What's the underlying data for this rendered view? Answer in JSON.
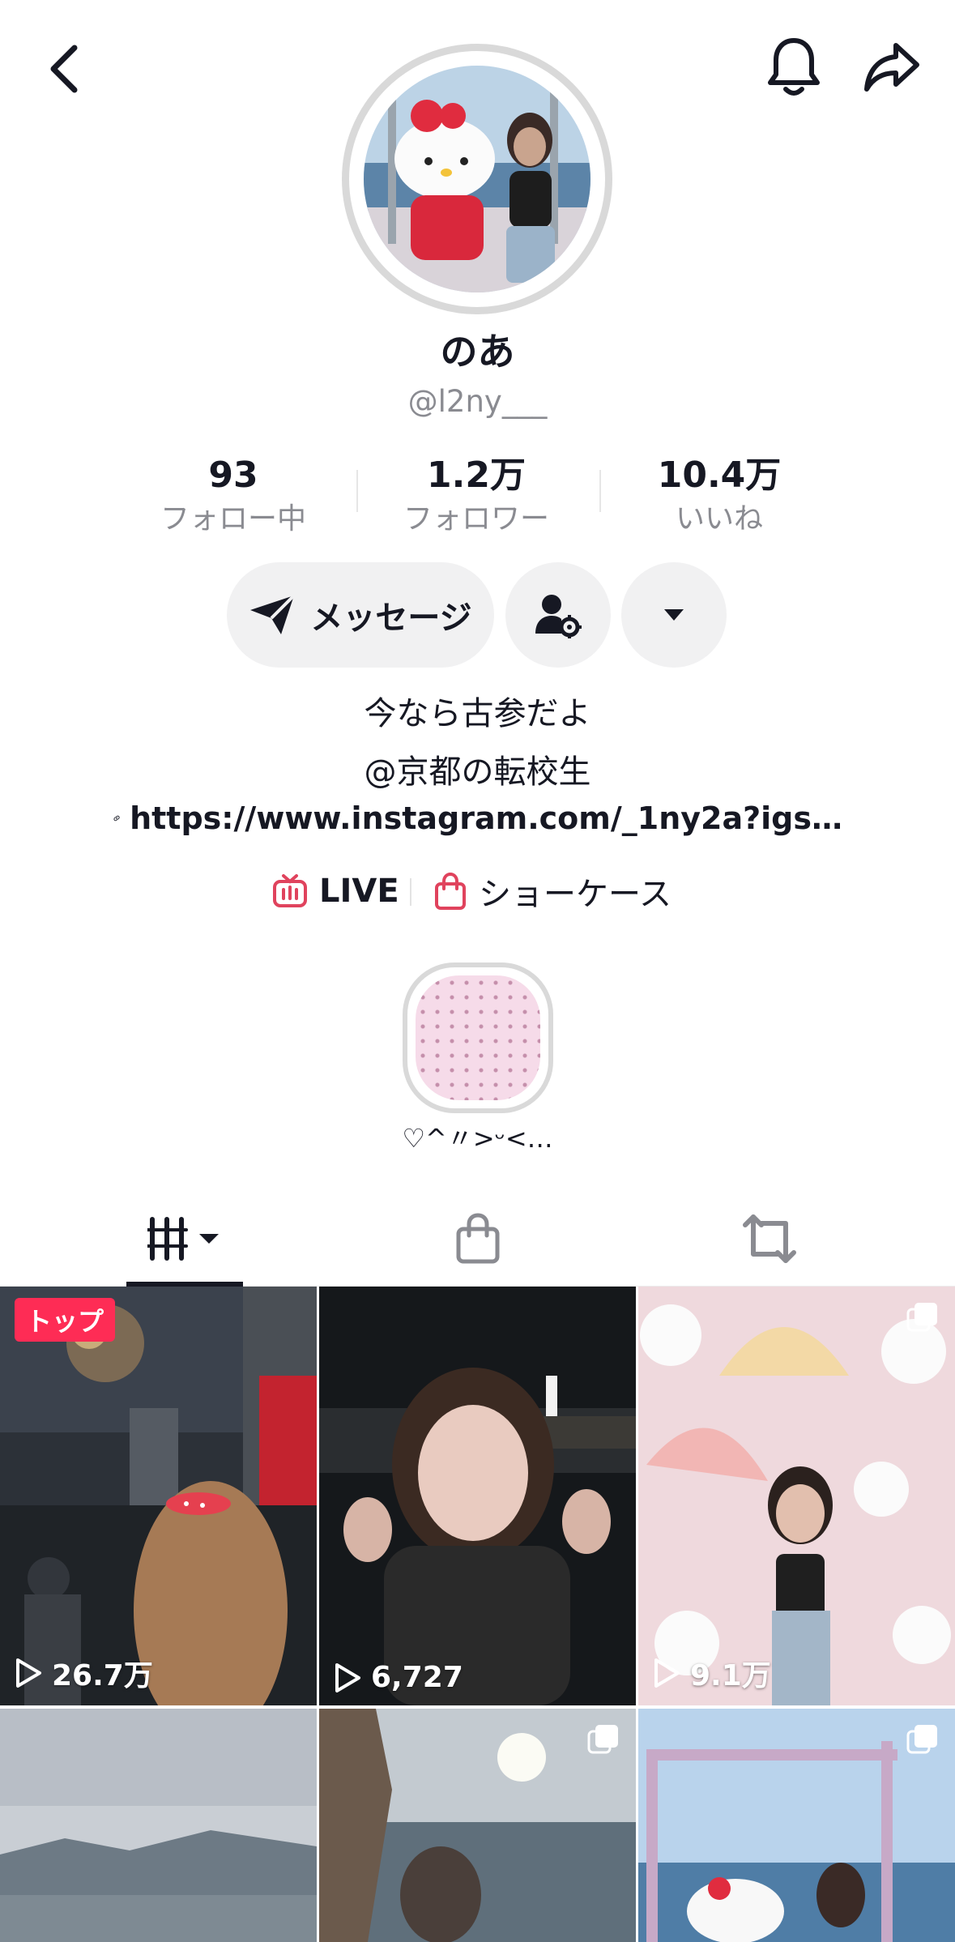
{
  "profile": {
    "display_name": "のあ",
    "username": "@l2ny___",
    "stats": [
      {
        "value": "93",
        "label": "フォロー中"
      },
      {
        "value": "1.2万",
        "label": "フォロワー"
      },
      {
        "value": "10.4万",
        "label": "いいね"
      }
    ],
    "message_label": "メッセージ",
    "bio_line1": "今なら古参だよ",
    "bio_line2": "@京都の転校生",
    "bio_link": "https://www.instagram.com/_1ny2a?igs…",
    "features": {
      "live": "LIVE",
      "showcase": "ショーケース"
    },
    "highlight_label": "♡^〃>ᵕ<…"
  },
  "colors": {
    "accent": "#fe2c55",
    "text": "#161823",
    "secondary": "#8a8b91",
    "pill": "#f1f1f2"
  },
  "icons": [
    "back-icon",
    "bell-icon",
    "share-icon",
    "send-icon",
    "friend-settings-icon",
    "caret-down-icon",
    "link-icon",
    "live-tv-icon",
    "shopping-bag-icon",
    "videos-grid-icon",
    "repost-icon",
    "play-icon",
    "multi-image-icon"
  ],
  "grid": {
    "pinned_label": "トップ",
    "videos": [
      {
        "views": "26.7万"
      },
      {
        "views": "6,727"
      },
      {
        "views": "9.1万"
      }
    ]
  }
}
